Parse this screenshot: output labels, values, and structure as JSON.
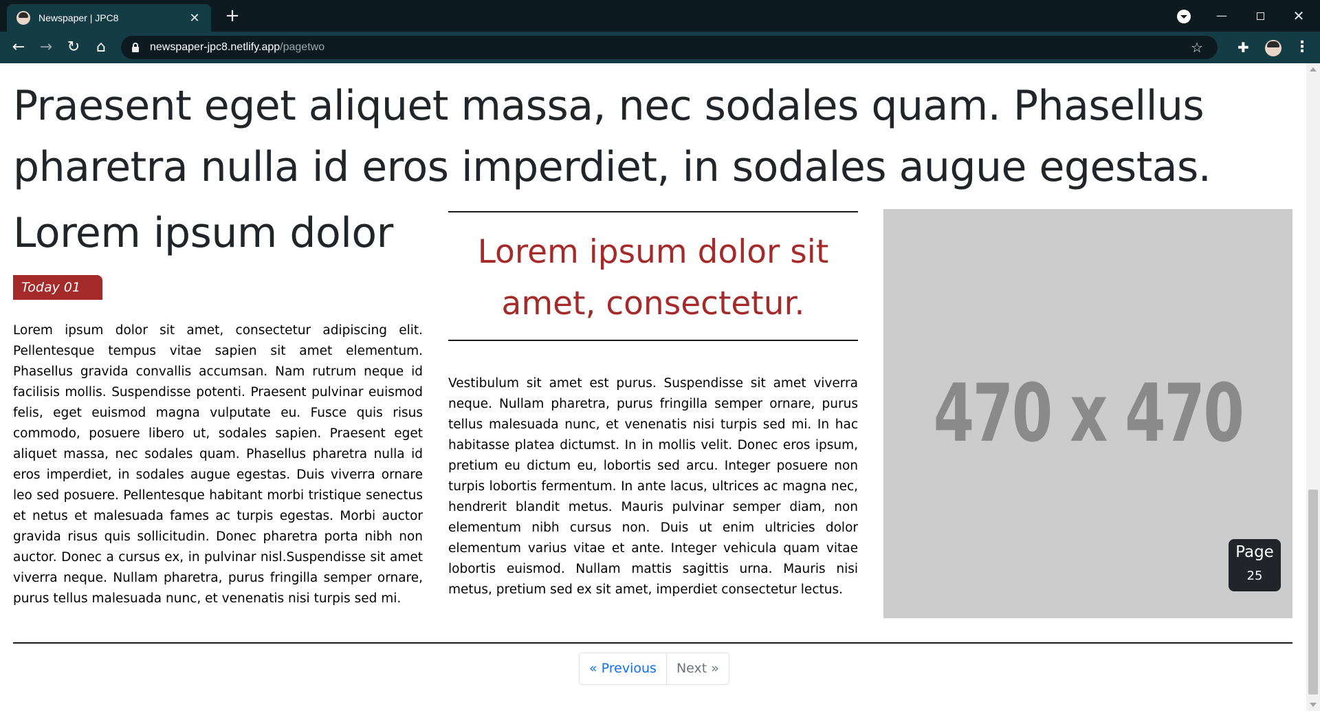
{
  "browser": {
    "tab_title": "Newspaper | JPC8",
    "tab_close": "✕",
    "new_tab": "+",
    "url_host": "newspaper-jpc8.netlify.app",
    "url_path": "/pagetwo",
    "window_controls": {
      "minimize": "—",
      "close": "✕"
    },
    "icons": [
      "back-icon",
      "forward-icon",
      "reload-icon",
      "home-icon",
      "lock-icon",
      "star-icon",
      "extensions-icon",
      "profile-icon",
      "menu-icon"
    ]
  },
  "page": {
    "headline": "Praesent eget aliquet massa, nec sodales quam. Phasellus pharetra nulla id eros imperdiet, in sodales augue egestas.",
    "left_column": {
      "title": "Lorem ipsum dolor",
      "date_badge": "Today 01",
      "body": "Lorem ipsum dolor sit amet, consectetur adipiscing elit. Pellentesque tempus vitae sapien sit amet elementum. Phasellus gravida convallis accumsan. Nam rutrum neque id facilisis mollis. Suspendisse potenti. Praesent pulvinar euismod felis, eget euismod magna vulputate eu. Fusce quis risus commodo, posuere libero ut, sodales sapien. Praesent eget aliquet massa, nec sodales quam. Phasellus pharetra nulla id eros imperdiet, in sodales augue egestas. Duis viverra ornare leo sed posuere. Pellentesque habitant morbi tristique senectus et netus et malesuada fames ac turpis egestas. Morbi auctor gravida risus quis sollicitudin. Donec pharetra porta nibh non auctor. Donec a cursus ex, in pulvinar nisl.Suspendisse sit amet viverra neque. Nullam pharetra, purus fringilla semper ornare, purus tellus malesuada nunc, et venenatis nisi turpis sed mi."
    },
    "middle_column": {
      "pull_quote": "Lorem ipsum dolor sit amet, consectetur.",
      "body": "Vestibulum sit amet est purus. Suspendisse sit amet viverra neque. Nullam pharetra, purus fringilla semper ornare, purus tellus malesuada nunc, et venenatis nisi turpis sed mi. In hac habitasse platea dictumst. In in mollis velit. Donec eros ipsum, pretium eu dictum eu, lobortis sed arcu. Integer posuere non turpis lobortis fermentum. In ante lacus, ultrices ac magna nec, hendrerit blandit metus. Mauris pulvinar semper diam, non elementum nibh cursus non. Duis ut enim ultricies dolor elementum varius vitae et ante. Integer vehicula quam vitae lobortis euismod. Nullam mattis sagittis urna. Mauris nisi metus, pretium sed ex sit amet, imperdiet consectetur lectus."
    },
    "right_column": {
      "image_text": "470 x 470",
      "page_label": "Page",
      "page_number": "25"
    },
    "pagination": {
      "previous": "« Previous",
      "next": "Next »"
    }
  },
  "colors": {
    "accent_red": "#a52a2a",
    "link_blue": "#0d6efd",
    "chrome_dark": "#0d1b21",
    "chrome_toolbar": "#133c44",
    "placeholder_gray": "#cccccc"
  }
}
